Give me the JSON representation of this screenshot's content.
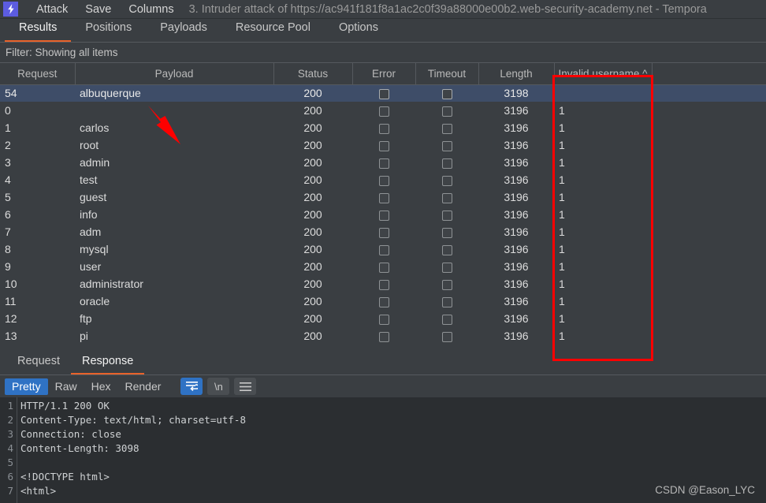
{
  "window": {
    "app_icon": "burp-lightning-icon",
    "menu": [
      "Attack",
      "Save",
      "Columns"
    ],
    "title": "3. Intruder attack of https://ac941f181f8a1ac2c0f39a88000e00b2.web-security-academy.net - Tempora"
  },
  "tabs": [
    {
      "label": "Results",
      "active": true
    },
    {
      "label": "Positions",
      "active": false
    },
    {
      "label": "Payloads",
      "active": false
    },
    {
      "label": "Resource Pool",
      "active": false
    },
    {
      "label": "Options",
      "active": false
    }
  ],
  "filter": {
    "text": "Filter: Showing all items"
  },
  "results": {
    "columns": [
      {
        "label": "Request"
      },
      {
        "label": "Payload"
      },
      {
        "label": "Status"
      },
      {
        "label": "Error"
      },
      {
        "label": "Timeout"
      },
      {
        "label": "Length"
      },
      {
        "label": "Invalid username ^"
      },
      {
        "label": ""
      }
    ],
    "sort_column": "Invalid username",
    "sort_indicator": "^",
    "rows": [
      {
        "request": "54",
        "payload": "albuquerque",
        "status": "200",
        "length": "3198",
        "invalid": "",
        "selected": true
      },
      {
        "request": "0",
        "payload": "",
        "status": "200",
        "length": "3196",
        "invalid": "1",
        "selected": false
      },
      {
        "request": "1",
        "payload": "carlos",
        "status": "200",
        "length": "3196",
        "invalid": "1",
        "selected": false
      },
      {
        "request": "2",
        "payload": "root",
        "status": "200",
        "length": "3196",
        "invalid": "1",
        "selected": false
      },
      {
        "request": "3",
        "payload": "admin",
        "status": "200",
        "length": "3196",
        "invalid": "1",
        "selected": false
      },
      {
        "request": "4",
        "payload": "test",
        "status": "200",
        "length": "3196",
        "invalid": "1",
        "selected": false
      },
      {
        "request": "5",
        "payload": "guest",
        "status": "200",
        "length": "3196",
        "invalid": "1",
        "selected": false
      },
      {
        "request": "6",
        "payload": "info",
        "status": "200",
        "length": "3196",
        "invalid": "1",
        "selected": false
      },
      {
        "request": "7",
        "payload": "adm",
        "status": "200",
        "length": "3196",
        "invalid": "1",
        "selected": false
      },
      {
        "request": "8",
        "payload": "mysql",
        "status": "200",
        "length": "3196",
        "invalid": "1",
        "selected": false
      },
      {
        "request": "9",
        "payload": "user",
        "status": "200",
        "length": "3196",
        "invalid": "1",
        "selected": false
      },
      {
        "request": "10",
        "payload": "administrator",
        "status": "200",
        "length": "3196",
        "invalid": "1",
        "selected": false
      },
      {
        "request": "11",
        "payload": "oracle",
        "status": "200",
        "length": "3196",
        "invalid": "1",
        "selected": false
      },
      {
        "request": "12",
        "payload": "ftp",
        "status": "200",
        "length": "3196",
        "invalid": "1",
        "selected": false
      },
      {
        "request": "13",
        "payload": "pi",
        "status": "200",
        "length": "3196",
        "invalid": "1",
        "selected": false
      }
    ]
  },
  "message_panel": {
    "tabs": [
      {
        "label": "Request",
        "active": false
      },
      {
        "label": "Response",
        "active": true
      }
    ],
    "view_modes": [
      {
        "label": "Pretty",
        "active": true
      },
      {
        "label": "Raw",
        "active": false
      },
      {
        "label": "Hex",
        "active": false
      },
      {
        "label": "Render",
        "active": false
      }
    ],
    "icons": [
      {
        "name": "word-wrap-icon",
        "label": "",
        "active": true
      },
      {
        "name": "newline-icon",
        "label": "\\n",
        "active": false
      },
      {
        "name": "menu-icon",
        "label": "",
        "active": false
      }
    ],
    "code": [
      {
        "n": "1",
        "text": "HTTP/1.1 200 OK",
        "tag": false
      },
      {
        "n": "2",
        "text": "Content-Type: text/html; charset=utf-8",
        "tag": false
      },
      {
        "n": "3",
        "text": "Connection: close",
        "tag": false
      },
      {
        "n": "4",
        "text": "Content-Length: 3098",
        "tag": false
      },
      {
        "n": "5",
        "text": "",
        "tag": false
      },
      {
        "n": "6",
        "text": "<!DOCTYPE html>",
        "tag": true
      },
      {
        "n": "7",
        "text": "<html>",
        "tag": true
      }
    ]
  },
  "watermark": {
    "text": "CSDN @Eason_LYC"
  },
  "annotations": {
    "box_color": "#fe0000",
    "arrow_color": "#fe0000",
    "box_label": "invalid-username-column-highlight",
    "arrow_label": "albuquerque-payload-pointer"
  },
  "colors": {
    "accent": "#e8622a",
    "selection": "#3e4d68",
    "background": "#3a3e42",
    "code_background": "#2b2e31",
    "active_mode": "#2f72c4",
    "logo": "#5c5ce0"
  }
}
